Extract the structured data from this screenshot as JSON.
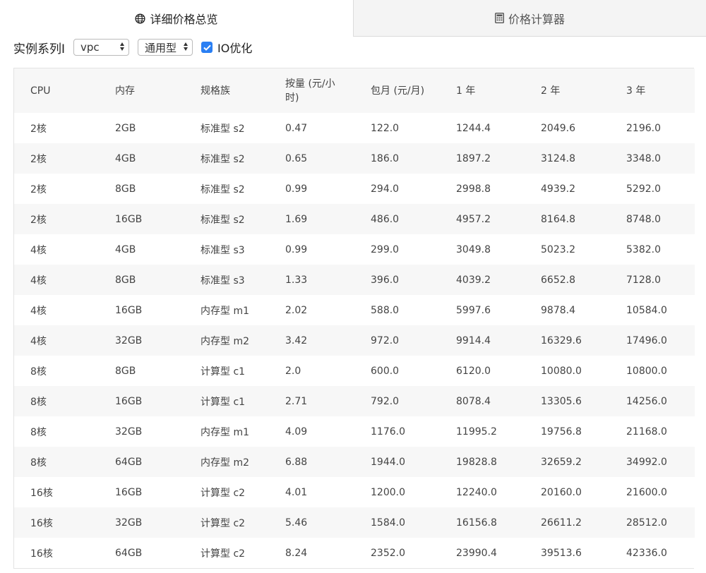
{
  "tabs": {
    "overview_label": "详细价格总览",
    "calculator_label": "价格计算器"
  },
  "filters": {
    "label": "实例系列I",
    "network_select_value": "vpc",
    "type_select_value": "通用型",
    "io_optimized_label": "IO优化",
    "io_optimized_checked": true
  },
  "colors": {
    "accent": "#2a7ff3",
    "row_alt": "#f7f7f7",
    "tab_inactive_bg": "#f4f4f4"
  },
  "table": {
    "headers": [
      "CPU",
      "内存",
      "规格族",
      "按量 (元/小时)",
      "包月 (元/月)",
      "1 年",
      "2 年",
      "3 年"
    ],
    "rows": [
      [
        "2核",
        "2GB",
        "标准型 s2",
        "0.47",
        "122.0",
        "1244.4",
        "2049.6",
        "2196.0"
      ],
      [
        "2核",
        "4GB",
        "标准型 s2",
        "0.65",
        "186.0",
        "1897.2",
        "3124.8",
        "3348.0"
      ],
      [
        "2核",
        "8GB",
        "标准型 s2",
        "0.99",
        "294.0",
        "2998.8",
        "4939.2",
        "5292.0"
      ],
      [
        "2核",
        "16GB",
        "标准型 s2",
        "1.69",
        "486.0",
        "4957.2",
        "8164.8",
        "8748.0"
      ],
      [
        "4核",
        "4GB",
        "标准型 s3",
        "0.99",
        "299.0",
        "3049.8",
        "5023.2",
        "5382.0"
      ],
      [
        "4核",
        "8GB",
        "标准型 s3",
        "1.33",
        "396.0",
        "4039.2",
        "6652.8",
        "7128.0"
      ],
      [
        "4核",
        "16GB",
        "内存型 m1",
        "2.02",
        "588.0",
        "5997.6",
        "9878.4",
        "10584.0"
      ],
      [
        "4核",
        "32GB",
        "内存型 m2",
        "3.42",
        "972.0",
        "9914.4",
        "16329.6",
        "17496.0"
      ],
      [
        "8核",
        "8GB",
        "计算型 c1",
        "2.0",
        "600.0",
        "6120.0",
        "10080.0",
        "10800.0"
      ],
      [
        "8核",
        "16GB",
        "计算型 c1",
        "2.71",
        "792.0",
        "8078.4",
        "13305.6",
        "14256.0"
      ],
      [
        "8核",
        "32GB",
        "内存型 m1",
        "4.09",
        "1176.0",
        "11995.2",
        "19756.8",
        "21168.0"
      ],
      [
        "8核",
        "64GB",
        "内存型 m2",
        "6.88",
        "1944.0",
        "19828.8",
        "32659.2",
        "34992.0"
      ],
      [
        "16核",
        "16GB",
        "计算型 c2",
        "4.01",
        "1200.0",
        "12240.0",
        "20160.0",
        "21600.0"
      ],
      [
        "16核",
        "32GB",
        "计算型 c2",
        "5.46",
        "1584.0",
        "16156.8",
        "26611.2",
        "28512.0"
      ],
      [
        "16核",
        "64GB",
        "计算型 c2",
        "8.24",
        "2352.0",
        "23990.4",
        "39513.6",
        "42336.0"
      ]
    ]
  }
}
